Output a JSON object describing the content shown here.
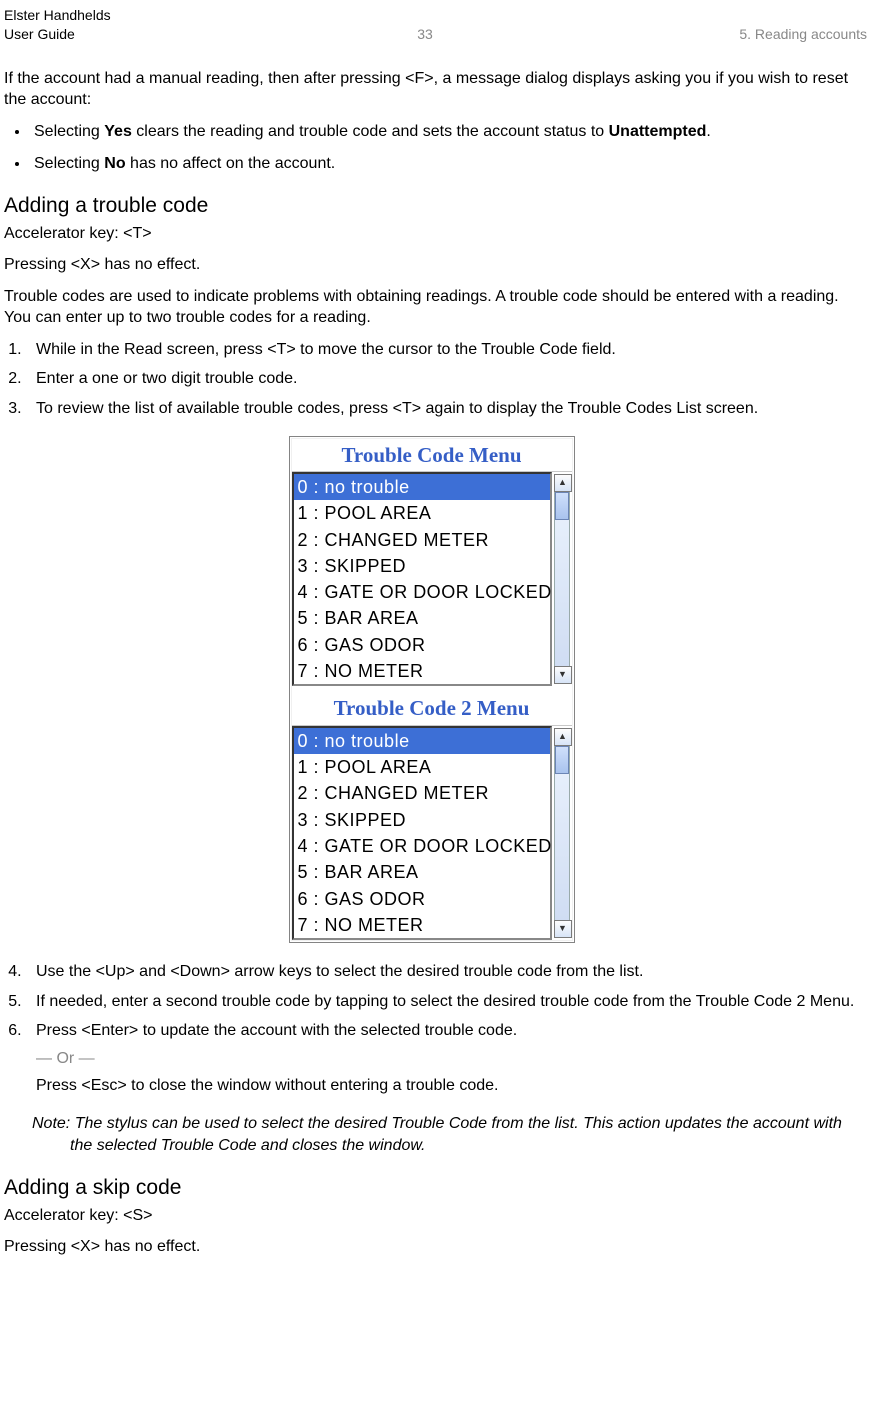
{
  "header": {
    "left_line1": "Elster Handhelds",
    "left_line2": "User Guide",
    "page_number": "33",
    "chapter": "5. Reading accounts"
  },
  "intro_para": "If the account had a manual reading, then after pressing <F>, a message dialog displays asking you if you wish to reset the account:",
  "bullets": {
    "yes_pre": "Selecting ",
    "yes_bold": "Yes",
    "yes_mid": " clears the reading and trouble code and sets the account status to ",
    "yes_bold2": "Unattempted",
    "yes_end": ".",
    "no_pre": "Selecting ",
    "no_bold": "No",
    "no_end": " has no affect on the account."
  },
  "section1": {
    "heading": "Adding a trouble code",
    "accel": "Accelerator key: <T>",
    "noeffect": "Pressing <X> has no effect.",
    "para": "Trouble codes are used to indicate problems with obtaining readings. A trouble code should be entered with a reading. You can enter up to two trouble codes for a reading.",
    "step1": "While in the Read screen, press <T> to move the cursor to the Trouble Code field.",
    "step2": "Enter a one or two digit trouble code.",
    "step3": "To review the list of available trouble codes, press <T> again to display the Trouble Codes List screen.",
    "step4": "Use the <Up> and <Down> arrow keys to select the desired trouble code from the list.",
    "step5": "If needed, enter a second trouble code by tapping to select the desired trouble code from the Trouble Code 2 Menu.",
    "step6": "Press <Enter> to update the account with the selected trouble code.",
    "or": "— Or —",
    "step6b": "Press <Esc> to close the window without entering a trouble code.",
    "note": "Note: The stylus can be used to select the desired Trouble Code from the list. This action updates the account with the selected Trouble Code and closes the window."
  },
  "menu": {
    "title1": "Trouble Code Menu",
    "title2": "Trouble Code 2 Menu",
    "items": [
      "0  : no trouble",
      "1  : POOL AREA",
      "2  : CHANGED METER",
      "3  : SKIPPED",
      "4  : GATE OR DOOR LOCKED",
      "5  : BAR AREA",
      "6  : GAS ODOR",
      "7  : NO METER"
    ]
  },
  "section2": {
    "heading": "Adding a skip code",
    "accel": "Accelerator key: <S>",
    "noeffect": "Pressing <X> has no effect."
  }
}
